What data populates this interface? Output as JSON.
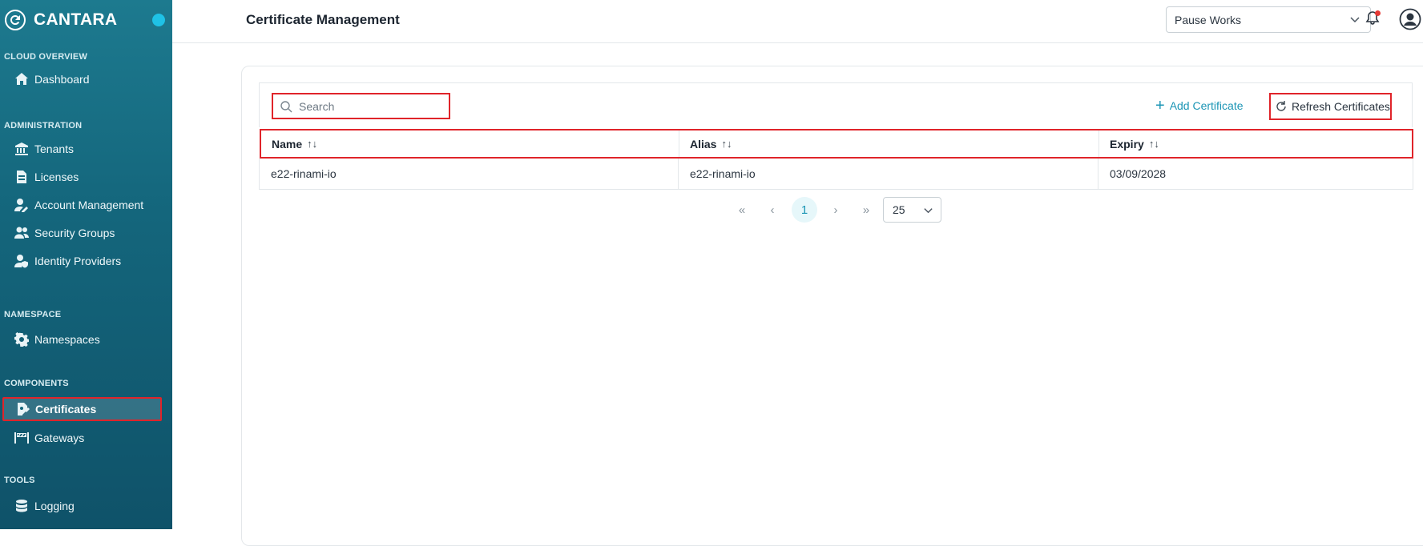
{
  "brand": {
    "name": "CANTARA",
    "logo_icon": "cantara-logo-icon",
    "status_color": "#1fc2e6"
  },
  "sidebar": {
    "sections": [
      {
        "title": "CLOUD OVERVIEW",
        "items": [
          {
            "label": "Dashboard",
            "icon": "home-icon"
          }
        ]
      },
      {
        "title": "ADMINISTRATION",
        "items": [
          {
            "label": "Tenants",
            "icon": "building-icon"
          },
          {
            "label": "Licenses",
            "icon": "license-icon"
          },
          {
            "label": "Account Management",
            "icon": "user-edit-icon"
          },
          {
            "label": "Security Groups",
            "icon": "users-icon"
          },
          {
            "label": "Identity Providers",
            "icon": "user-shield-icon"
          }
        ]
      },
      {
        "title": "NAMESPACE",
        "items": [
          {
            "label": "Namespaces",
            "icon": "gear-icon"
          }
        ]
      },
      {
        "title": "COMPONENTS",
        "items": [
          {
            "label": "Certificates",
            "icon": "certificate-icon",
            "active": true
          },
          {
            "label": "Gateways",
            "icon": "gateway-icon"
          }
        ]
      },
      {
        "title": "TOOLS",
        "items": [
          {
            "label": "Logging",
            "icon": "database-icon"
          }
        ]
      }
    ]
  },
  "header": {
    "title": "Certificate Management",
    "tenant_select": {
      "value": "Pause Works"
    },
    "notification_icon": "bell-icon",
    "user_icon": "user-circle-icon"
  },
  "toolbar": {
    "search_placeholder": "Search",
    "add_label": "Add Certificate",
    "refresh_label": "Refresh Certificates"
  },
  "table": {
    "columns": [
      {
        "label": "Name",
        "sort": "↑↓"
      },
      {
        "label": "Alias",
        "sort": "↑↓"
      },
      {
        "label": "Expiry",
        "sort": "↑↓"
      }
    ],
    "rows": [
      {
        "name": "e22-rinami-io",
        "alias": "e22-rinami-io",
        "expiry": "03/09/2028"
      }
    ]
  },
  "pagination": {
    "first": "«",
    "prev": "‹",
    "current_page": "1",
    "next": "›",
    "last": "»",
    "rows_per_page": "25"
  },
  "colors": {
    "accent": "#1b95b5",
    "highlight_border": "#e0242a",
    "sidebar_bg": "#14667c"
  }
}
